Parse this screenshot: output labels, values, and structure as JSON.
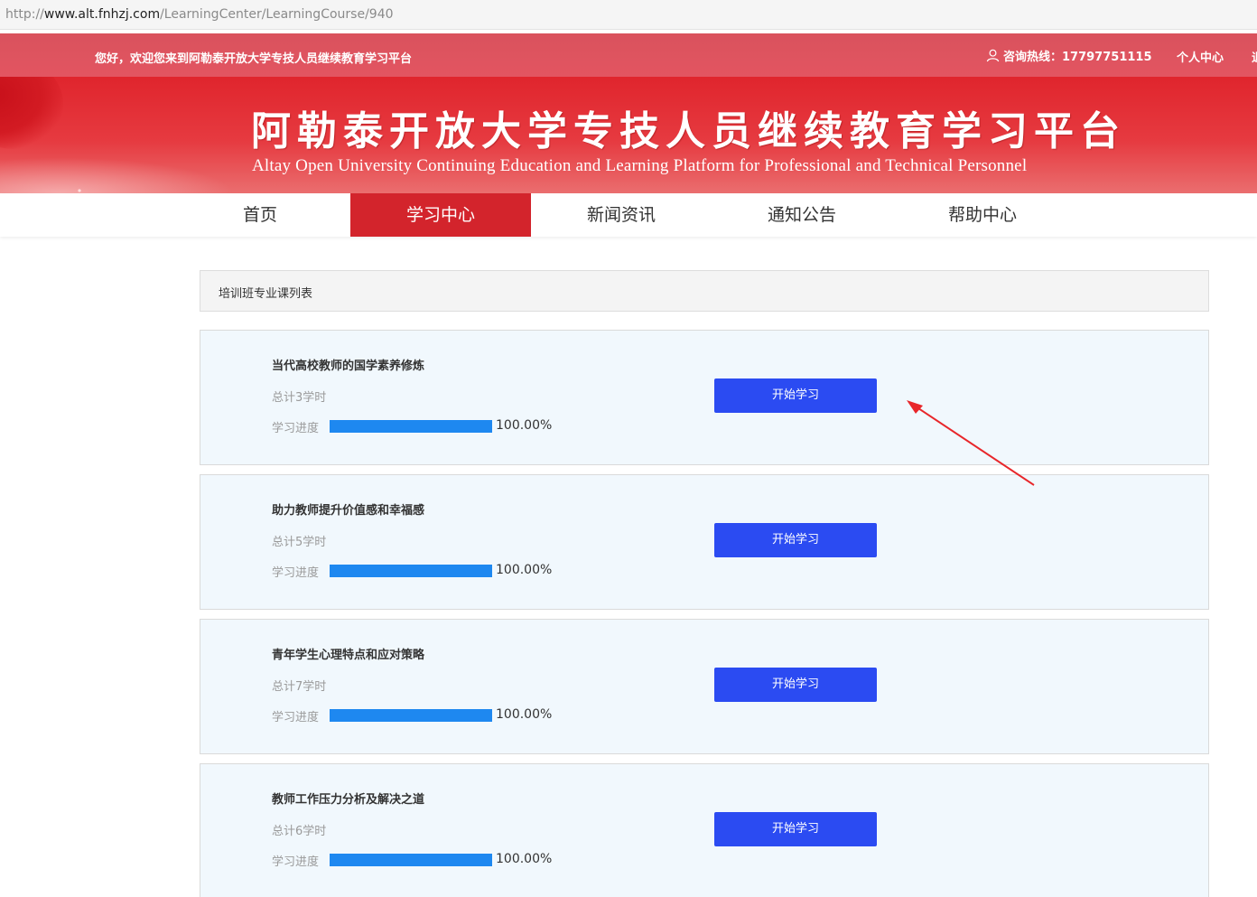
{
  "browser": {
    "url_scheme": "http://",
    "url_host": "www.alt.fnhzj.com",
    "url_path": "/LearningCenter/LearningCourse/940"
  },
  "topbar": {
    "welcome": "您好，欢迎您来到阿勒泰开放大学专技人员继续教育学习平台",
    "hotline": "咨询热线：17797751115",
    "personal_center": "个人中心",
    "cut_off_link": "退"
  },
  "banner": {
    "title_cn": "阿勒泰开放大学专技人员继续教育学习平台",
    "title_en": "Altay Open University Continuing Education and Learning Platform for Professional and Technical Personnel"
  },
  "nav": {
    "items": [
      "首页",
      "学习中心",
      "新闻资讯",
      "通知公告",
      "帮助中心"
    ],
    "active": "学习中心"
  },
  "section": {
    "title": "培训班专业课列表"
  },
  "courses": [
    {
      "name": "当代高校教师的国学素养修炼",
      "hours": "总计3学时",
      "progress_label": "学习进度",
      "progress": 1.0,
      "progress_text": "100.00%",
      "button": "开始学习"
    },
    {
      "name": "助力教师提升价值感和幸福感",
      "hours": "总计5学时",
      "progress_label": "学习进度",
      "progress": 1.0,
      "progress_text": "100.00%",
      "button": "开始学习"
    },
    {
      "name": "青年学生心理特点和应对策略",
      "hours": "总计7学时",
      "progress_label": "学习进度",
      "progress": 1.0,
      "progress_text": "100.00%",
      "button": "开始学习"
    },
    {
      "name": "教师工作压力分析及解决之道",
      "hours": "总计6学时",
      "progress_label": "学习进度",
      "progress": 1.0,
      "progress_text": "100.00%",
      "button": "开始学习"
    }
  ],
  "colors": {
    "brand_red": "#d3242c",
    "button_blue": "#2b4bf2",
    "progress_blue": "#1e88f0",
    "card_bg": "#f1f8fd",
    "annotation_arrow": "#e8262a"
  }
}
